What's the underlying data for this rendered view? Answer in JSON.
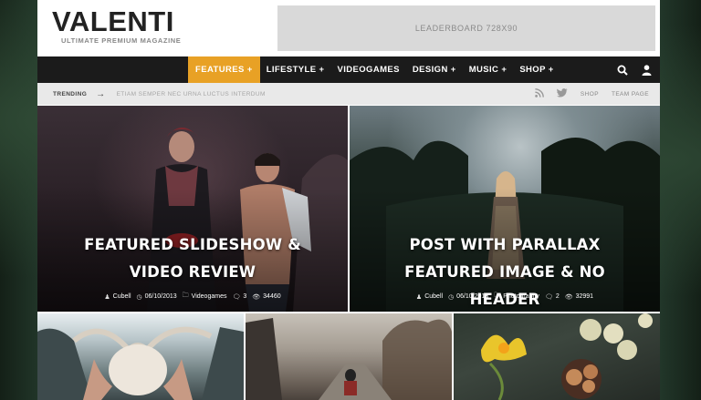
{
  "header": {
    "logo_main": "VALENTI",
    "logo_tagline": "ULTIMATE PREMIUM MAGAZINE",
    "leaderboard": "LEADERBOARD 728X90"
  },
  "nav": {
    "items": [
      {
        "label": "FEATURES +"
      },
      {
        "label": "LIFESTYLE +"
      },
      {
        "label": "VIDEOGAMES"
      },
      {
        "label": "DESIGN +"
      },
      {
        "label": "MUSIC +"
      },
      {
        "label": "SHOP +"
      }
    ],
    "active_color": "#e8a125"
  },
  "trending": {
    "label": "TRENDING",
    "arrow": "→",
    "text": "ETIAM SEMPER NEC URNA LUCTUS INTERDUM",
    "links": [
      "SHOP",
      "TEAM PAGE"
    ]
  },
  "featured": [
    {
      "title": "FEATURED SLIDESHOW & VIDEO REVIEW",
      "author": "Cubell",
      "date": "06/10/2013",
      "category": "Videogames",
      "comments": "3",
      "views": "34460"
    },
    {
      "title": "POST WITH PARALLAX FEATURED IMAGE & NO HEADER",
      "author": "Cubell",
      "date": "06/10/2013",
      "category": "Photography",
      "comments": "2",
      "views": "32991"
    }
  ]
}
